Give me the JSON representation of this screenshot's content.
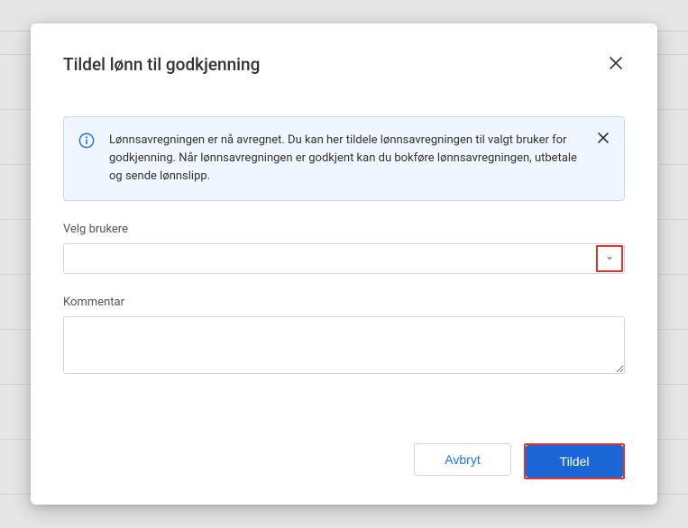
{
  "modal": {
    "title": "Tildel lønn til godkjenning",
    "info": {
      "text": "Lønnsavregningen er nå avregnet. Du kan her tildele lønnsavregningen til valgt bruker for godkjenning. Når lønnsavregningen er godkjent kan du bokføre lønnsavregningen, utbetale og sende lønnslipp."
    },
    "fields": {
      "users_label": "Velg brukere",
      "users_value": "",
      "comment_label": "Kommentar",
      "comment_value": ""
    },
    "buttons": {
      "cancel": "Avbryt",
      "submit": "Tildel"
    }
  }
}
